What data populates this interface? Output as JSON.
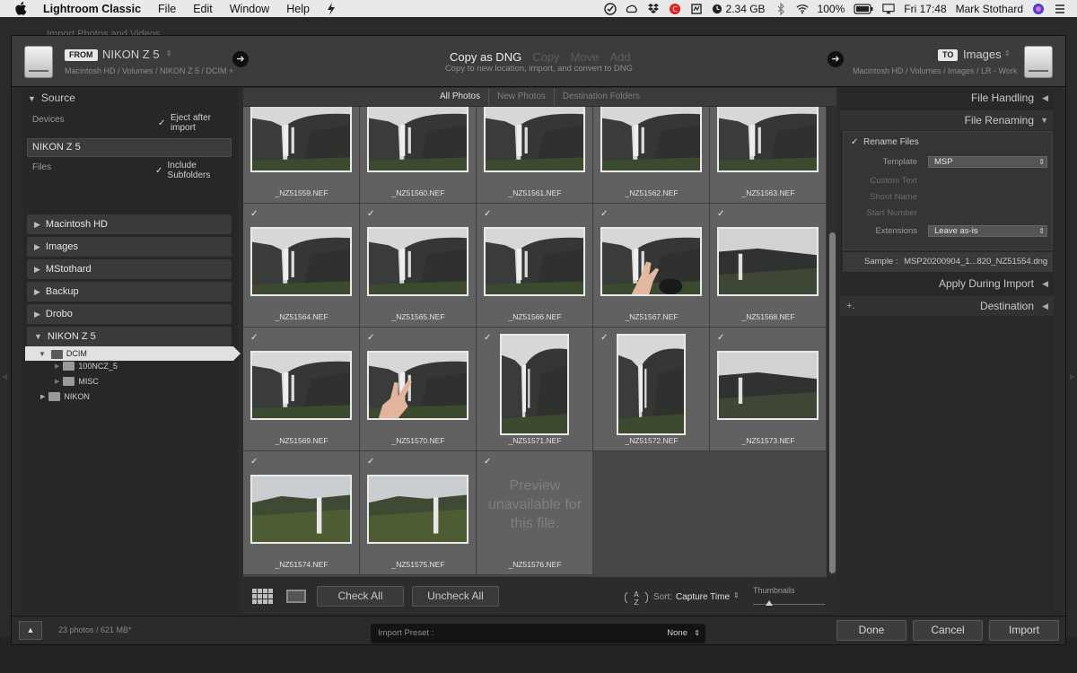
{
  "menubar": {
    "app_name": "Lightroom Classic",
    "menus": [
      "File",
      "Edit",
      "Window",
      "Help"
    ],
    "memory": "2.34 GB",
    "battery": "100%",
    "clock": "Fri 17:48",
    "user": "Mark Stothard"
  },
  "background_window": {
    "title": "Import Photos and Videos"
  },
  "header": {
    "from_tag": "FROM",
    "source_name": "NIKON Z 5",
    "source_path": "Macintosh HD / Volumes / NIKON Z 5 / DCIM +",
    "modes": [
      {
        "label": "Copy as DNG",
        "active": true
      },
      {
        "label": "Copy",
        "active": false
      },
      {
        "label": "Move",
        "active": false
      },
      {
        "label": "Add",
        "active": false
      }
    ],
    "mode_description": "Copy to new location, import, and convert to DNG",
    "to_tag": "TO",
    "dest_name": "Images",
    "dest_path": "Macintosh HD / Volumes / Images / LR - Work"
  },
  "source_panel": {
    "title": "Source",
    "devices_label": "Devices",
    "eject_label": "Eject after import",
    "device_name": "NIKON Z 5",
    "files_label": "Files",
    "subfolders_label": "Include Subfolders",
    "volumes": [
      "Macintosh HD",
      "Images",
      "MStothard",
      "Backup",
      "Drobo",
      "NIKON Z 5"
    ],
    "tree": {
      "selected": "DCIM",
      "children": [
        "100NCZ_5",
        "MISC"
      ],
      "sibling": "NIKON"
    }
  },
  "filter_tabs": [
    "All Photos",
    "New Photos",
    "Destination Folders"
  ],
  "grid": {
    "no_preview_text": "Preview unavailable for this file.",
    "photos": [
      {
        "file": "_NZ51559.NEF",
        "kind": "landscape",
        "checked": true
      },
      {
        "file": "_NZ51560.NEF",
        "kind": "landscape",
        "checked": true
      },
      {
        "file": "_NZ51561.NEF",
        "kind": "landscape",
        "checked": true
      },
      {
        "file": "_NZ51562.NEF",
        "kind": "landscape",
        "checked": true
      },
      {
        "file": "_NZ51563.NEF",
        "kind": "landscape",
        "checked": true
      },
      {
        "file": "_NZ51564.NEF",
        "kind": "landscape",
        "checked": true
      },
      {
        "file": "_NZ51565.NEF",
        "kind": "landscape",
        "checked": true
      },
      {
        "file": "_NZ51566.NEF",
        "kind": "landscape",
        "checked": true
      },
      {
        "file": "_NZ51567.NEF",
        "kind": "hand",
        "checked": true
      },
      {
        "file": "_NZ51568.NEF",
        "kind": "wide",
        "checked": true
      },
      {
        "file": "_NZ51569.NEF",
        "kind": "landscape",
        "checked": true
      },
      {
        "file": "_NZ51570.NEF",
        "kind": "peace",
        "checked": true
      },
      {
        "file": "_NZ51571.NEF",
        "kind": "portrait",
        "checked": true
      },
      {
        "file": "_NZ51572.NEF",
        "kind": "portrait",
        "checked": true
      },
      {
        "file": "_NZ51573.NEF",
        "kind": "wide",
        "checked": true
      },
      {
        "file": "_NZ51574.NEF",
        "kind": "green",
        "checked": true
      },
      {
        "file": "_NZ51575.NEF",
        "kind": "green",
        "checked": true
      },
      {
        "file": "_NZ51576.NEF",
        "kind": "none",
        "checked": true
      }
    ]
  },
  "toolbar": {
    "check_all": "Check All",
    "uncheck_all": "Uncheck All",
    "sort_label": "Sort:",
    "sort_value": "Capture Time",
    "thumbnails_label": "Thumbnails"
  },
  "right_panel": {
    "file_handling": "File Handling",
    "file_renaming": "File Renaming",
    "rename_files": "Rename Files",
    "template_label": "Template",
    "template_value": "MSP",
    "custom_text_label": "Custom Text",
    "shoot_name_label": "Shoot Name",
    "start_number_label": "Start Number",
    "extensions_label": "Extensions",
    "extensions_value": "Leave as-is",
    "sample_label": "Sample :",
    "sample_value": "MSP20200904_1...820_NZ51554.dng",
    "apply_during_import": "Apply During Import",
    "destination": "Destination",
    "destination_plus": "+."
  },
  "footer": {
    "count": "23 photos / 621 MB*",
    "done": "Done",
    "cancel": "Cancel",
    "import": "Import",
    "preset_label": "Import Preset :",
    "preset_value": "None"
  },
  "colors": {
    "dialog_bg": "#2b2b2b",
    "grid_cell": "#616161",
    "selection": "#e1e1e1"
  }
}
